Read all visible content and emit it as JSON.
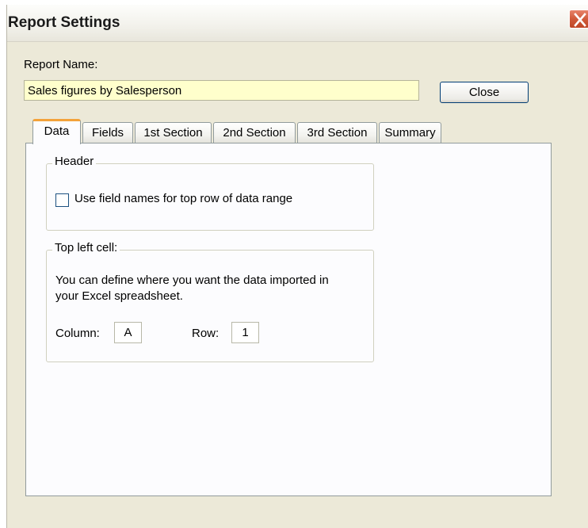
{
  "window": {
    "title": "Report Settings"
  },
  "report_name": {
    "label": "Report Name:",
    "value": "Sales figures by Salesperson"
  },
  "close_button": {
    "label": "Close"
  },
  "tabs": [
    {
      "label": "Data",
      "active": true
    },
    {
      "label": "Fields",
      "active": false
    },
    {
      "label": "1st Section",
      "active": false
    },
    {
      "label": "2nd Section",
      "active": false
    },
    {
      "label": "3rd Section",
      "active": false
    },
    {
      "label": "Summary",
      "active": false
    }
  ],
  "header_group": {
    "legend": "Header",
    "checkbox_label": "Use field names for top row of data range",
    "checked": false
  },
  "top_left_group": {
    "legend": "Top left cell:",
    "description_line1": "You can define where you want the data imported in",
    "description_line2": "your Excel spreadsheet.",
    "column_label": "Column:",
    "column_value": "A",
    "row_label": "Row:",
    "row_value": "1"
  },
  "colors": {
    "dialog_bg": "#ece9d8",
    "input_bg": "#ffffcc",
    "tab_accent": "#f3a23a",
    "close_x_bg": "#d05a3a"
  },
  "icons": {
    "window_close": "close-icon"
  }
}
